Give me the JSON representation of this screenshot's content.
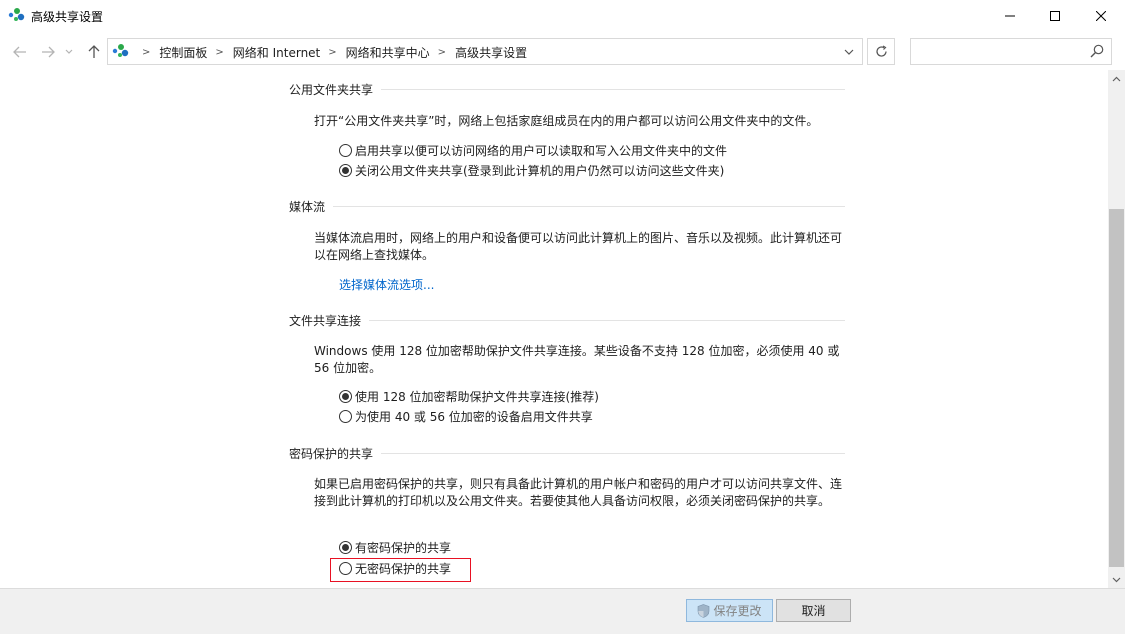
{
  "window": {
    "title": "高级共享设置"
  },
  "address_bar": {
    "breadcrumbs": [
      "控制面板",
      "网络和 Internet",
      "网络和共享中心",
      "高级共享设置"
    ],
    "search_placeholder": ""
  },
  "sections": {
    "public_folder": {
      "heading": "公用文件夹共享",
      "description": "打开“公用文件夹共享”时，网络上包括家庭组成员在内的用户都可以访问公用文件夹中的文件。",
      "options": [
        {
          "label": "启用共享以便可以访问网络的用户可以读取和写入公用文件夹中的文件",
          "checked": false
        },
        {
          "label": "关闭公用文件夹共享(登录到此计算机的用户仍然可以访问这些文件夹)",
          "checked": true
        }
      ]
    },
    "media_streaming": {
      "heading": "媒体流",
      "description": "当媒体流启用时，网络上的用户和设备便可以访问此计算机上的图片、音乐以及视频。此计算机还可以在网络上查找媒体。",
      "link": "选择媒体流选项..."
    },
    "file_sharing": {
      "heading": "文件共享连接",
      "description": "Windows 使用 128 位加密帮助保护文件共享连接。某些设备不支持 128 位加密，必须使用 40 或 56 位加密。",
      "options": [
        {
          "label": "使用 128 位加密帮助保护文件共享连接(推荐)",
          "checked": true
        },
        {
          "label": "为使用 40 或 56 位加密的设备启用文件共享",
          "checked": false
        }
      ]
    },
    "password_protected": {
      "heading": "密码保护的共享",
      "description": "如果已启用密码保护的共享，则只有具备此计算机的用户帐户和密码的用户才可以访问共享文件、连接到此计算机的打印机以及公用文件夹。若要使其他人具备访问权限，必须关闭密码保护的共享。",
      "options": [
        {
          "label": "有密码保护的共享",
          "checked": true
        },
        {
          "label": "无密码保护的共享",
          "checked": false
        }
      ]
    }
  },
  "footer": {
    "save_label": "保存更改",
    "cancel_label": "取消"
  },
  "colors": {
    "link": "#0066cc",
    "highlight": "#e81123",
    "footer_bg": "#f0f0f0"
  }
}
